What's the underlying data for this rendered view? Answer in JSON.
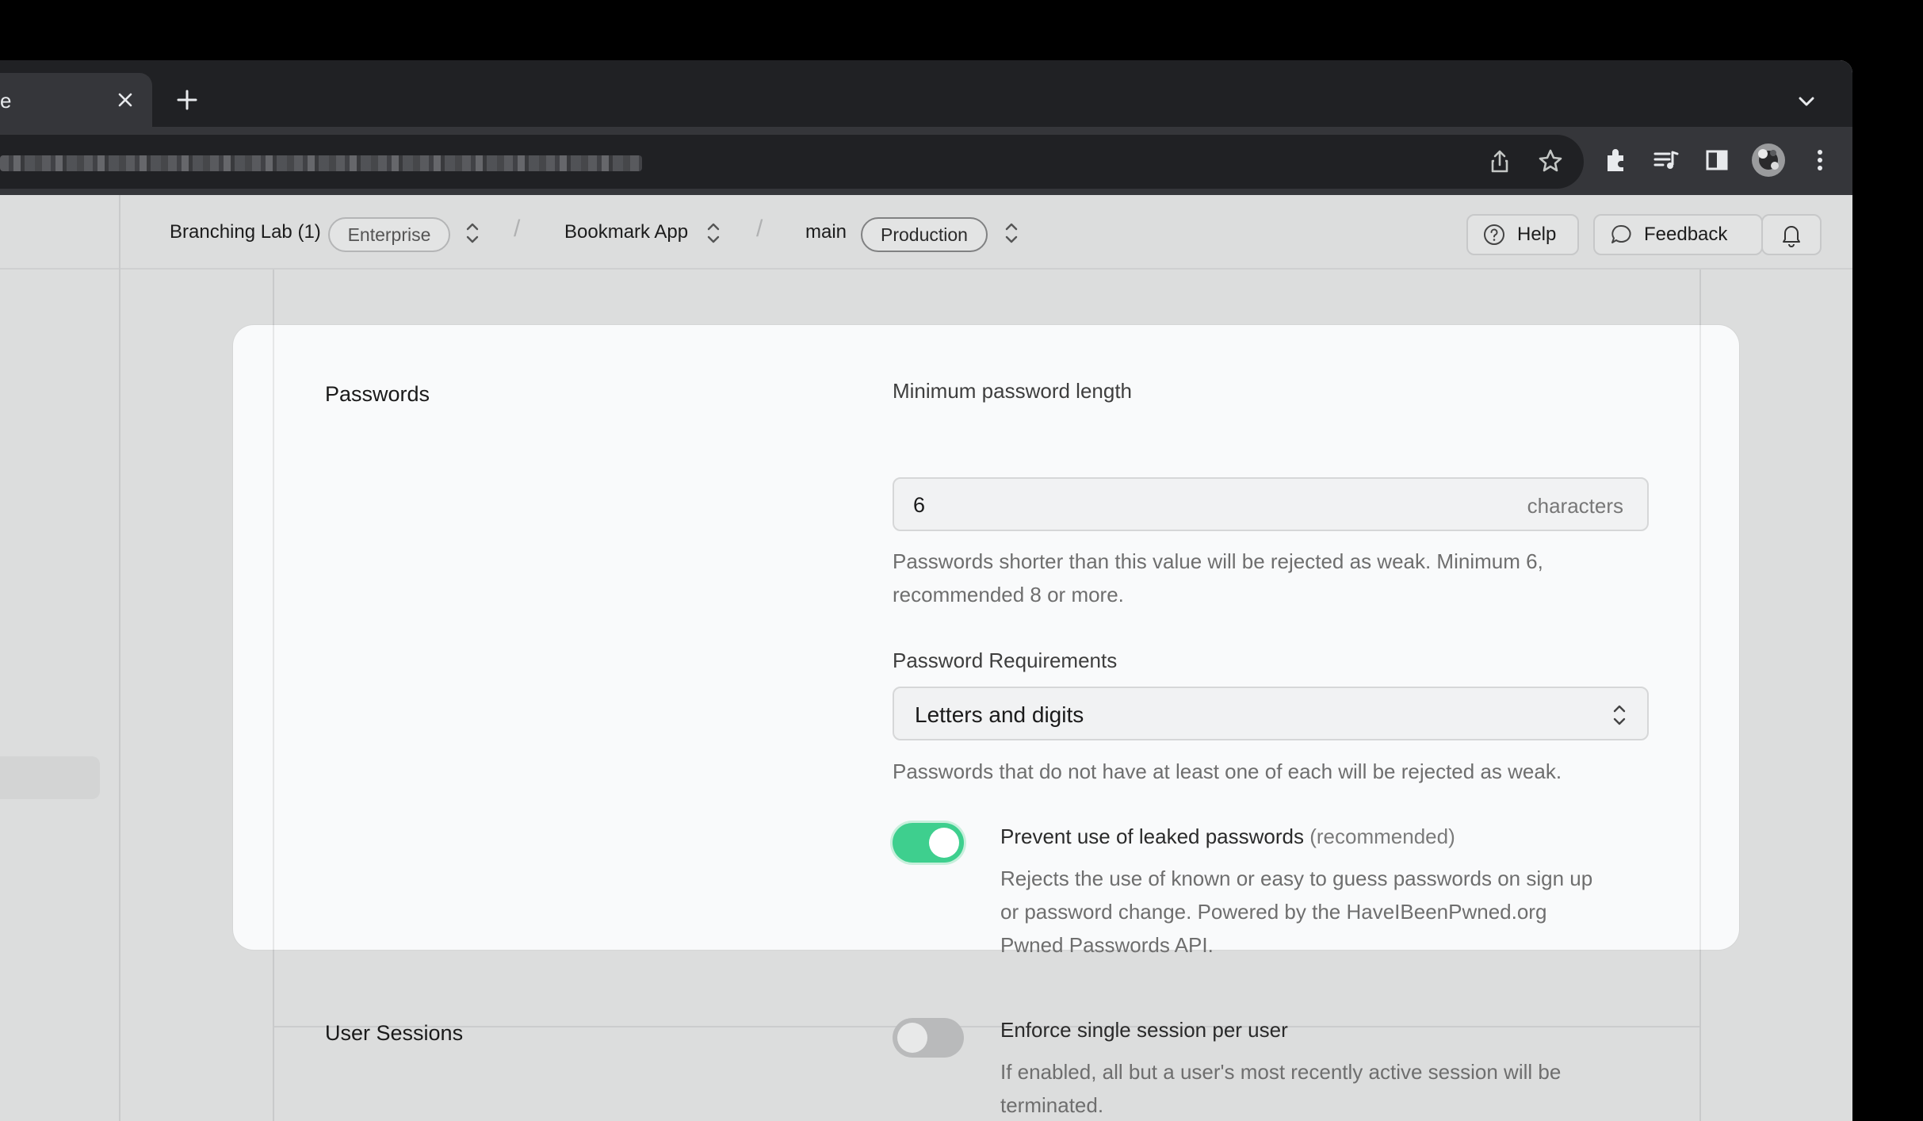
{
  "browser": {
    "tab": {
      "title": "e",
      "close_glyph": "✕"
    },
    "new_tab_glyph": "+",
    "toolbar_icons": [
      "share-icon",
      "star-icon",
      "extensions-icon",
      "media-icon",
      "sidepanel-icon",
      "profile-avatar",
      "menu-icon"
    ]
  },
  "header": {
    "org": {
      "name": "Branching Lab (1)",
      "plan": "Enterprise"
    },
    "project": {
      "name": "Bookmark App"
    },
    "branch": {
      "name": "main",
      "env": "Production"
    },
    "buttons": {
      "help": "Help",
      "feedback": "Feedback"
    }
  },
  "passwords": {
    "section_title": "Passwords",
    "min_length": {
      "label": "Minimum password length",
      "value": "6",
      "suffix": "characters",
      "description_line1": "Passwords shorter than this value will be rejected as weak. Minimum 6,",
      "description_line2": "recommended 8 or more."
    },
    "requirements": {
      "label": "Password Requirements",
      "value": "Letters and digits",
      "description": "Passwords that do not have at least one of each will be rejected as weak."
    },
    "leaked": {
      "enabled": true,
      "label": "Prevent use of leaked passwords",
      "label_suffix": "(recommended)",
      "description_line1": "Rejects the use of known or easy to guess passwords on sign up",
      "description_line2": "or password change. Powered by the HaveIBeenPwned.org",
      "description_line3": "Pwned Passwords API."
    }
  },
  "sessions": {
    "section_title": "User Sessions",
    "single_session": {
      "enabled": false,
      "label": "Enforce single session per user",
      "description_line1": "If enabled, all but a user's most recently active session will be",
      "description_line2": "terminated."
    }
  },
  "colors": {
    "accent": "#3ecf8e",
    "page_bg": "#dcdddd",
    "card_bg": "#f9fafb"
  }
}
